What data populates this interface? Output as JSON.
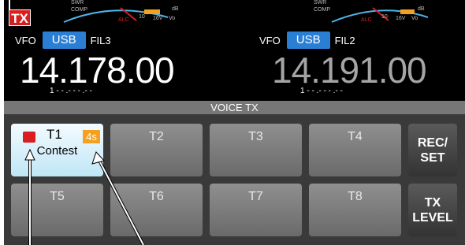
{
  "tx_badge": "TX",
  "meter_labels": [
    "SWR",
    "COMP",
    "ALC",
    "10",
    "16V",
    "Vo",
    "dB"
  ],
  "main": {
    "vfo": "VFO",
    "mode": "USB",
    "filter": "FIL3",
    "frequency": "14.178.00",
    "sub": "1 - - .- - - .- -"
  },
  "sub_band": {
    "vfo": "VFO",
    "mode": "USB",
    "filter": "FIL2",
    "frequency": "14.191.00",
    "sub": "1 - - .- - - .- -"
  },
  "panel": {
    "title": "VOICE TX",
    "buttons": [
      {
        "label": "T1",
        "seconds": "4s",
        "name": "Contest"
      },
      {
        "label": "T2"
      },
      {
        "label": "T3"
      },
      {
        "label": "T4"
      },
      {
        "label": "T5"
      },
      {
        "label": "T6"
      },
      {
        "label": "T7"
      },
      {
        "label": "T8"
      }
    ],
    "rec_set": "REC/\nSET",
    "tx_level": "TX\nLEVEL"
  },
  "colors": {
    "accent": "#2a7fd4",
    "tx_red": "#d81e1e",
    "active_button": "#cfeef9",
    "seconds_badge": "#f4a020"
  }
}
